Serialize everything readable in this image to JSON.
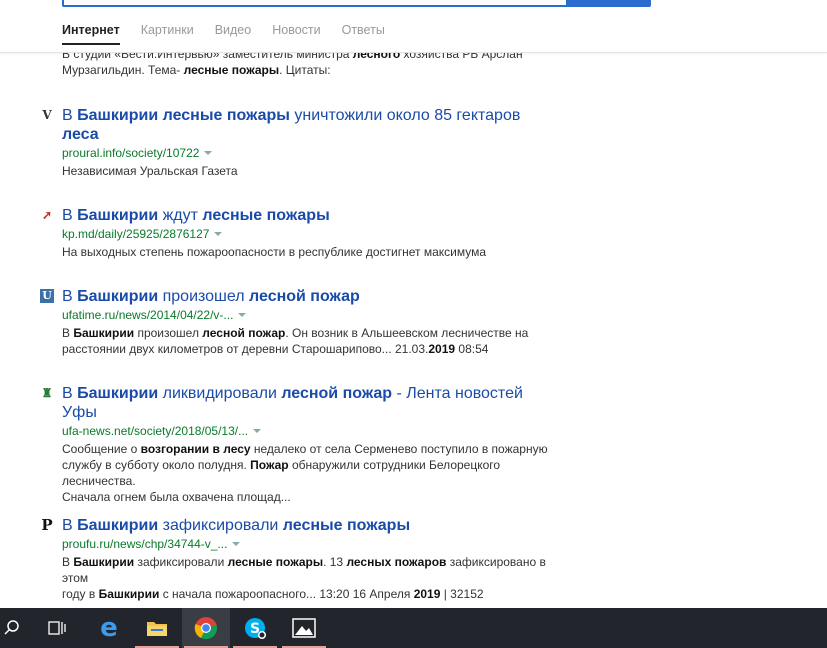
{
  "tabs": [
    "Интернет",
    "Картинки",
    "Видео",
    "Новости",
    "Ответы"
  ],
  "top_snippet": {
    "l1_a": "В студии «Вести.Интервью» заместитель министра ",
    "l1_b": "лесного",
    "l1_c": " хозяйства РБ Арслан",
    "l2_a": "Мурзагильдин. Тема- ",
    "l2_b": "лесные пожары",
    "l2_c": ". Цитаты:"
  },
  "results": [
    {
      "favicon": "V",
      "title": {
        "a": "В ",
        "b": "Башкирии",
        "c": " ",
        "d": "лесные пожары",
        "e": " уничтожили около 85 гектаров",
        "f": "леса"
      },
      "url": "proural.info/society/10722",
      "snippet_lines": [
        "Независимая Уральская Газета"
      ]
    },
    {
      "favicon": "➚",
      "title": {
        "a": "В ",
        "b": "Башкирии",
        "c": " ждут ",
        "d": "лесные пожары"
      },
      "url": "kp.md/daily/25925/2876127",
      "snippet_lines": [
        "На выходных степень пожароопасности в республике достигнет максимума"
      ]
    },
    {
      "favicon": "U",
      "title": {
        "a": "В ",
        "b": "Башкирии",
        "c": " произошел ",
        "d": "лесной пожар"
      },
      "url": "ufatime.ru/news/2014/04/22/v-...",
      "snippet": {
        "l1_a": "В ",
        "l1_b": "Башкирии",
        "l1_c": " произошел ",
        "l1_d": "лесной пожар",
        "l1_e": ". Он возник в Альшеевском лесничестве на",
        "l2_a": "расстоянии двух километров от деревни Старошарипово... 21.03.",
        "l2_b": "2019",
        "l2_c": " 08:54"
      }
    },
    {
      "favicon": "♜",
      "title": {
        "a": "В ",
        "b": "Башкирии",
        "c": " ликвидировали ",
        "d": "лесной пожар",
        "e": " - Лента новостей",
        "f": "Уфы"
      },
      "url": "ufa-news.net/society/2018/05/13/...",
      "snippet": {
        "l1_a": "Сообщение о ",
        "l1_b": "возгорании в лесу",
        "l1_c": " недалеко от села Серменево поступило в пожарную",
        "l2_a": "службу в субботу около полудня. ",
        "l2_b": "Пожар",
        "l2_c": " обнаружили сотрудники Белорецкого лесничества.",
        "l3": "Сначала огнем была охвачена площад..."
      }
    },
    {
      "favicon": "P",
      "title": {
        "a": "В ",
        "b": "Башкирии",
        "c": " зафиксировали ",
        "d": "лесные пожары"
      },
      "url": "proufu.ru/news/chp/34744-v_...",
      "snippet": {
        "l1_a": "В ",
        "l1_b": "Башкирии",
        "l1_c": " зафиксировали ",
        "l1_d": "лесные пожары",
        "l1_e": ". 13 ",
        "l1_f": "лесных пожаров",
        "l1_g": " зафиксировано в этом",
        "l2_a": "году в ",
        "l2_b": "Башкирии",
        "l2_c": " с начала пожароопасного... 13:20 16 Апреля ",
        "l2_d": "2019",
        "l2_e": " | 32152"
      }
    }
  ],
  "taskbar": {
    "icons": [
      "search-icon",
      "task-view-icon",
      "edge-icon",
      "file-explorer-icon",
      "chrome-icon",
      "skype-icon",
      "photos-icon"
    ],
    "accent": "#2a6bd0"
  }
}
